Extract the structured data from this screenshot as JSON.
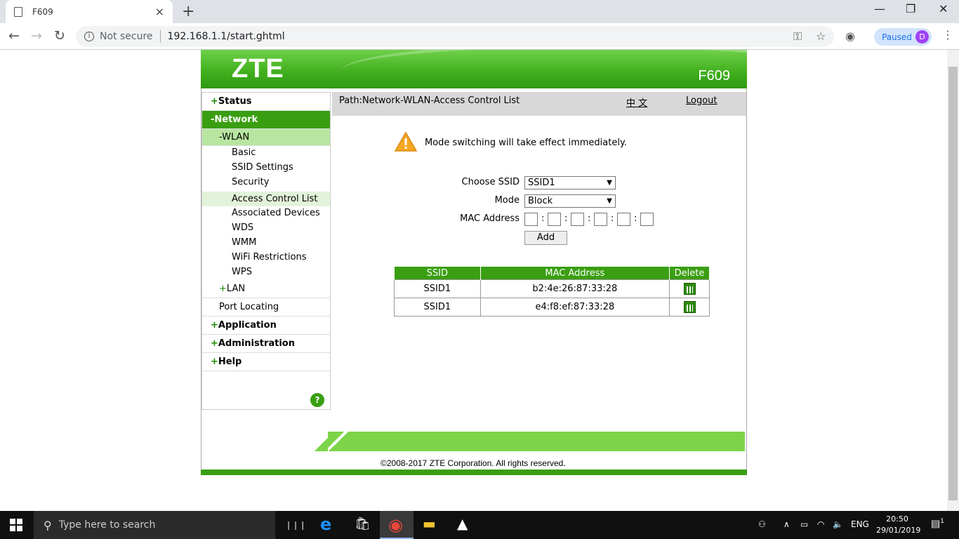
{
  "browser": {
    "tab_title": "F609",
    "close_glyph": "×",
    "new_tab_glyph": "+",
    "back_glyph": "←",
    "forward_glyph": "→",
    "reload_glyph": "↻",
    "not_secure": "Not secure",
    "url": "192.168.1.1/start.ghtml",
    "key_glyph": "⚿",
    "star_glyph": "☆",
    "paused_label": "Paused",
    "profile_initial": "D",
    "menu_glyph": "⋮",
    "minimize_glyph": "—",
    "maximize_glyph": "❐",
    "window_close_glyph": "✕"
  },
  "header": {
    "logo": "ZTE",
    "model": "F609"
  },
  "sidebar": {
    "status": "Status",
    "network": "-Network",
    "wlan": "-WLAN",
    "wlan_items": [
      "Basic",
      "SSID Settings",
      "Security",
      "Access Control List",
      "Associated Devices",
      "WDS",
      "WMM",
      "WiFi Restrictions",
      "WPS"
    ],
    "lan": "LAN",
    "port_locating": "Port Locating",
    "application": "Application",
    "administration": "Administration",
    "help": "Help",
    "plus": "+",
    "help_glyph": "?"
  },
  "content": {
    "path": "Path:Network-WLAN-Access Control List",
    "language": "中 文",
    "logout": "Logout",
    "warning": "Mode switching will take effect immediately.",
    "choose_ssid_label": "Choose SSID",
    "choose_ssid_value": "SSID1",
    "mode_label": "Mode",
    "mode_value": "Block",
    "mac_label": "MAC Address",
    "colon": ":",
    "dropdown_arrow": "▼",
    "add_button": "Add",
    "table": {
      "headers": [
        "SSID",
        "MAC Address",
        "Delete"
      ],
      "rows": [
        {
          "ssid": "SSID1",
          "mac": "b2:4e:26:87:33:28"
        },
        {
          "ssid": "SSID1",
          "mac": "e4:f8:ef:87:33:28"
        }
      ]
    }
  },
  "footer": {
    "copyright": "©2008-2017 ZTE Corporation. All rights reserved."
  },
  "taskbar": {
    "search_placeholder": "Type here to search",
    "search_glyph": "⚲",
    "language": "ENG",
    "time": "20:50",
    "date": "29/01/2019",
    "tray_people": "⚇",
    "tray_chevron": "∧",
    "tray_battery": "▭",
    "tray_wifi": "◠",
    "tray_volume": "🔈",
    "notifications_badge": "1",
    "task_view_glyph": "❘❘❘",
    "edge_glyph": "e",
    "store_glyph": "🛍",
    "chrome_glyph": "◉",
    "explorer_glyph": "▬",
    "photos_glyph": "▲"
  },
  "colors": {
    "zte_green": "#3a9e12",
    "light_green": "#7dd448",
    "wlan_highlight": "#b8e6a0"
  }
}
